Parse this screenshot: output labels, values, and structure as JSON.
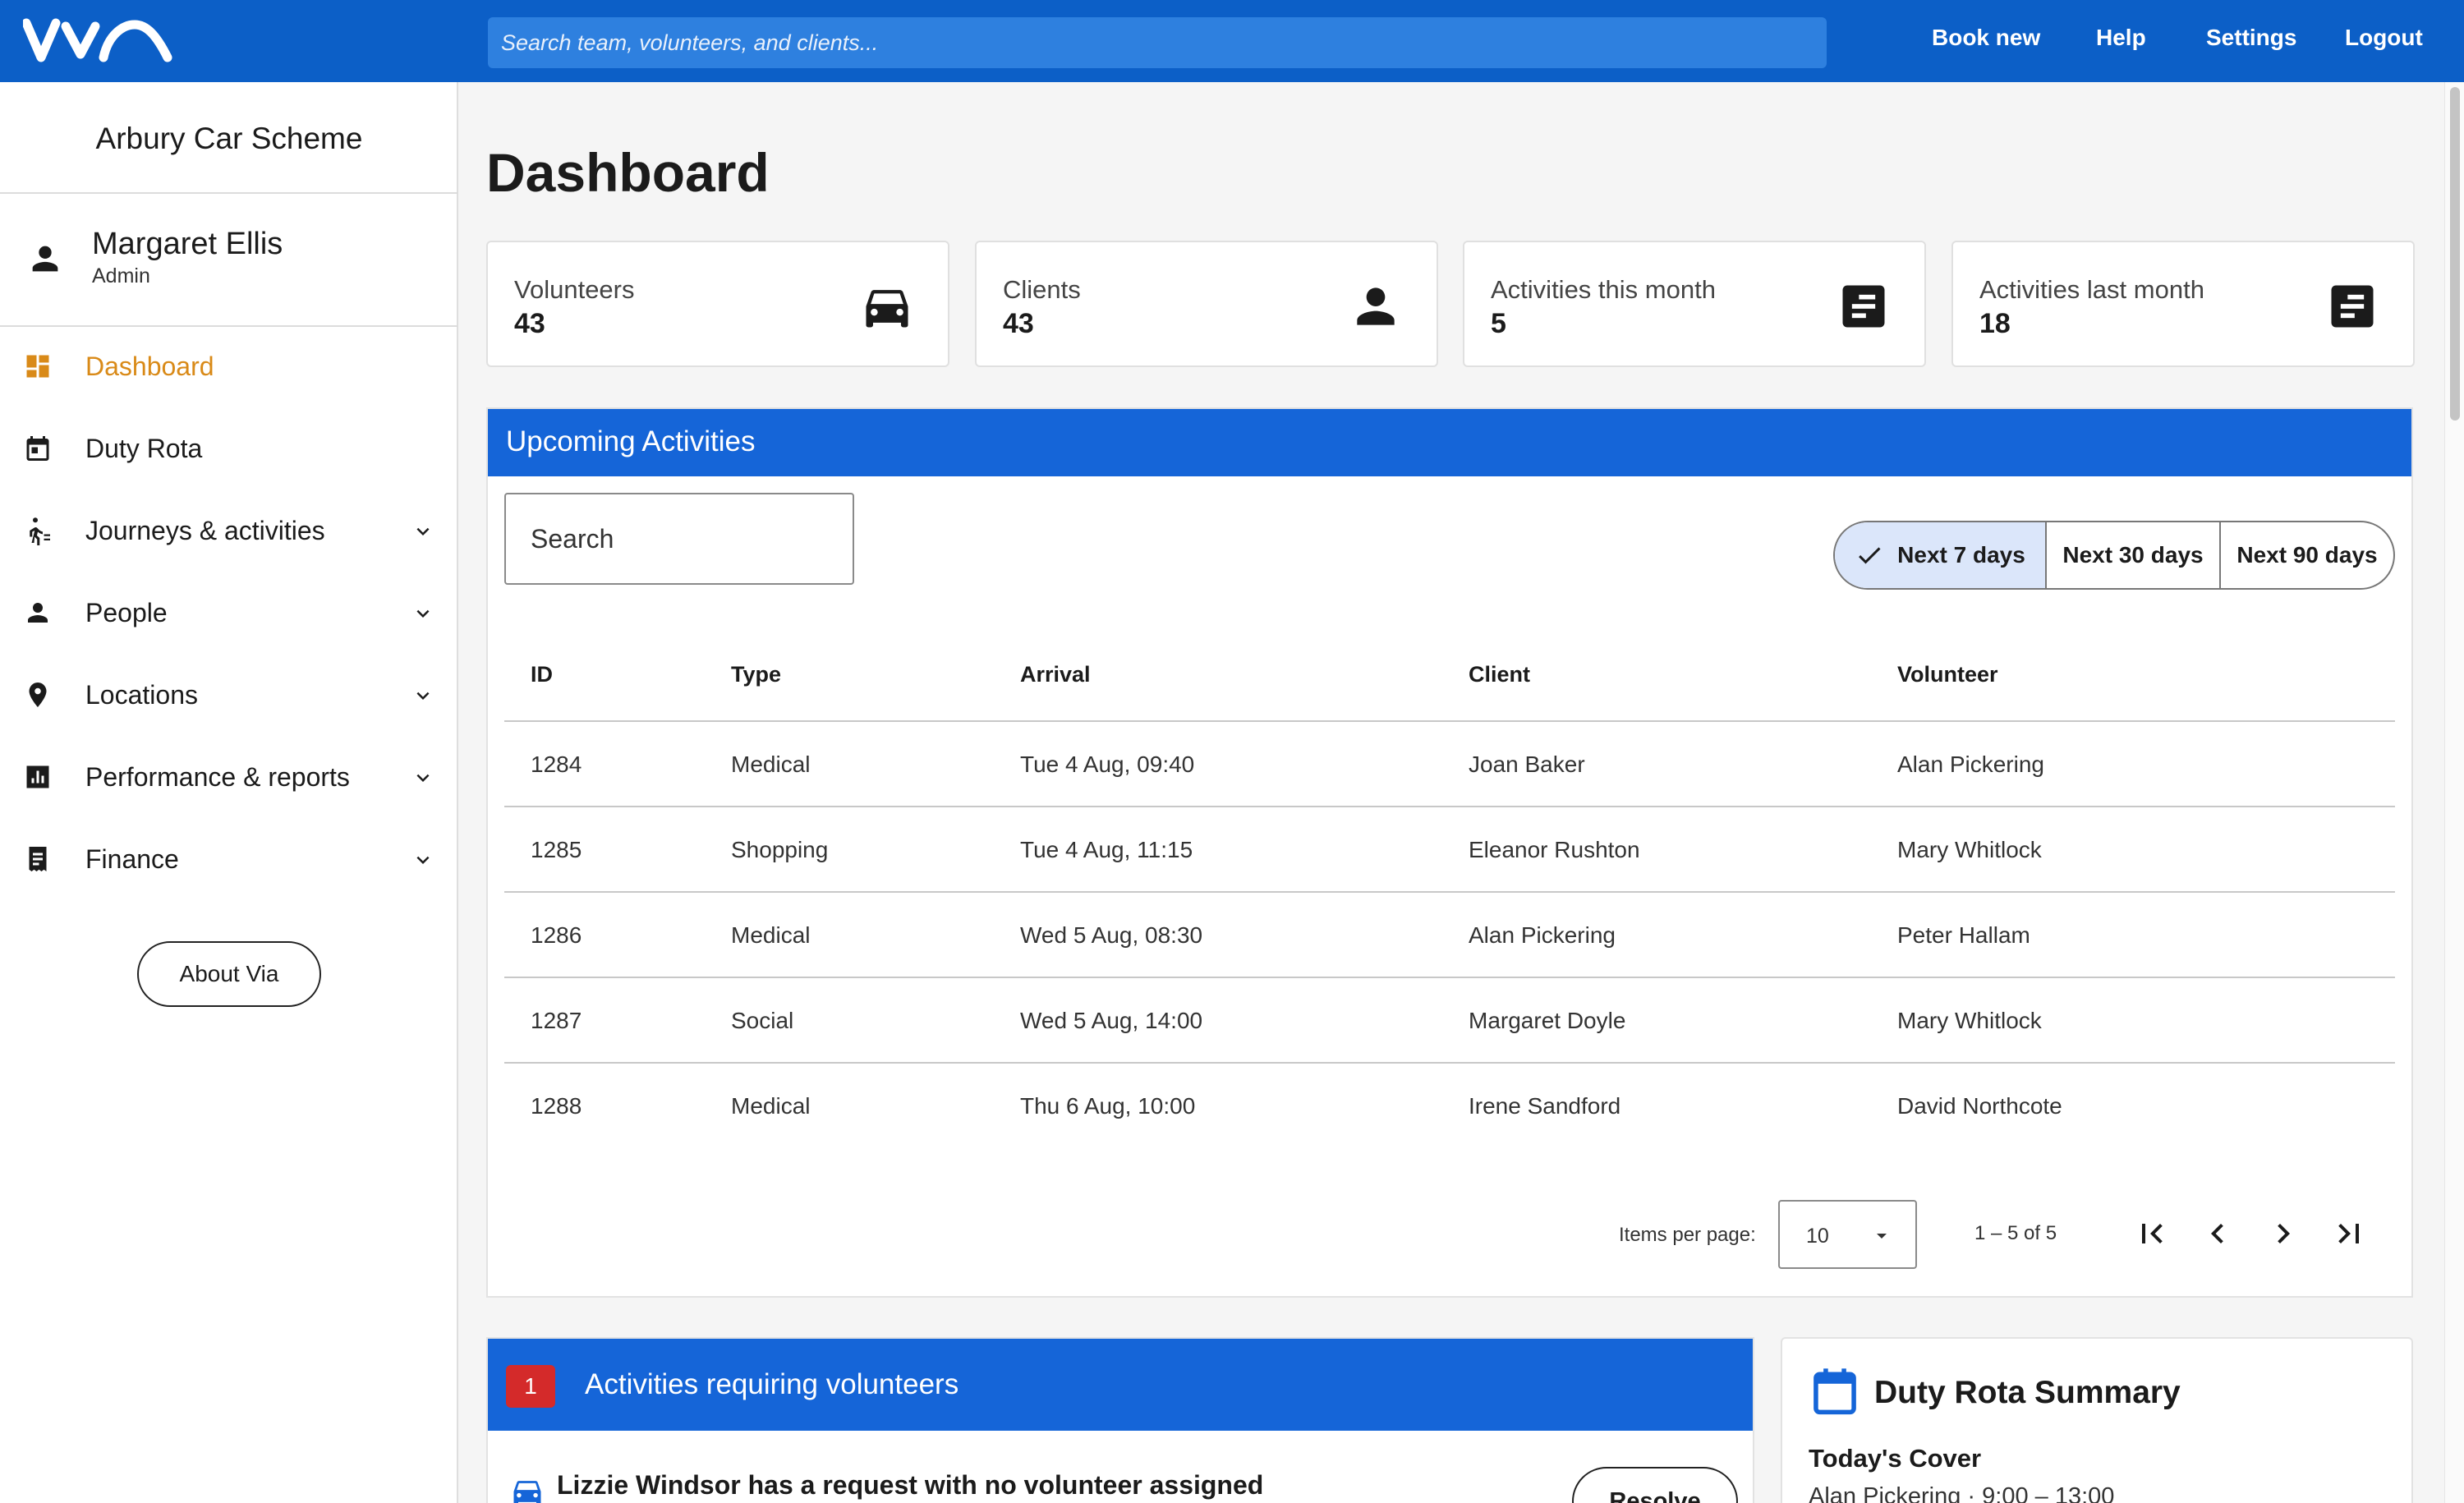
{
  "topbar": {
    "logo_text": "via",
    "search_placeholder": "Search team, volunteers, and clients...",
    "nav": [
      "Book new",
      "Help",
      "Settings",
      "Logout"
    ]
  },
  "sidebar": {
    "org_name": "Arbury Car Scheme",
    "user": {
      "name": "Margaret Ellis",
      "role": "Admin"
    },
    "items": [
      {
        "label": "Dashboard",
        "icon": "dashboard-icon",
        "active": true
      },
      {
        "label": "Duty Rota",
        "icon": "calendar-icon"
      },
      {
        "label": "Journeys & activities",
        "icon": "walking-icon",
        "expandable": true
      },
      {
        "label": "People",
        "icon": "person-icon",
        "expandable": true
      },
      {
        "label": "Locations",
        "icon": "location-pin-icon",
        "expandable": true
      },
      {
        "label": "Performance & reports",
        "icon": "bar-chart-icon",
        "expandable": true
      },
      {
        "label": "Finance",
        "icon": "receipt-icon",
        "expandable": true
      }
    ],
    "about_label": "About Via"
  },
  "main": {
    "title": "Dashboard",
    "stats": [
      {
        "label": "Volunteers",
        "value": "43",
        "icon": "car-icon"
      },
      {
        "label": "Clients",
        "value": "43",
        "icon": "person-icon"
      },
      {
        "label": "Activities this month",
        "value": "5",
        "icon": "notes-icon"
      },
      {
        "label": "Activities last month",
        "value": "18",
        "icon": "notes-icon"
      }
    ]
  },
  "upcoming": {
    "title": "Upcoming Activities",
    "search_placeholder": "Search",
    "filters": [
      "Next 7 days",
      "Next 30 days",
      "Next 90 days"
    ],
    "selected_filter": "Next 7 days",
    "columns": [
      "ID",
      "Type",
      "Arrival",
      "Client",
      "Volunteer"
    ],
    "rows": [
      [
        "1284",
        "Medical",
        "Tue 4 Aug, 09:40",
        "Joan Baker",
        "Alan Pickering"
      ],
      [
        "1285",
        "Shopping",
        "Tue 4 Aug, 11:15",
        "Eleanor Rushton",
        "Mary Whitlock"
      ],
      [
        "1286",
        "Medical",
        "Wed 5 Aug, 08:30",
        "Alan Pickering",
        "Peter Hallam"
      ],
      [
        "1287",
        "Social",
        "Wed 5 Aug, 14:00",
        "Margaret Doyle",
        "Mary Whitlock"
      ],
      [
        "1288",
        "Medical",
        "Thu 6 Aug, 10:00",
        "Irene Sandford",
        "David Northcote"
      ]
    ],
    "pagination": {
      "items_label": "Items per page:",
      "items_value": "10",
      "range": "1 – 5 of 5"
    }
  },
  "requiring": {
    "count": "1",
    "title": "Activities requiring volunteers",
    "item_text": "Lizzie Windsor has a request with no volunteer assigned",
    "resolve_label": "Resolve"
  },
  "rota": {
    "title": "Duty Rota Summary",
    "subtitle": "Today's Cover",
    "line": "Alan Pickering · 9:00 – 13:00"
  },
  "colors": {
    "brand_blue": "#0c5fc7",
    "panel_blue": "#1565d8",
    "active_orange": "#d98a18",
    "badge_red": "#d42a2a"
  }
}
